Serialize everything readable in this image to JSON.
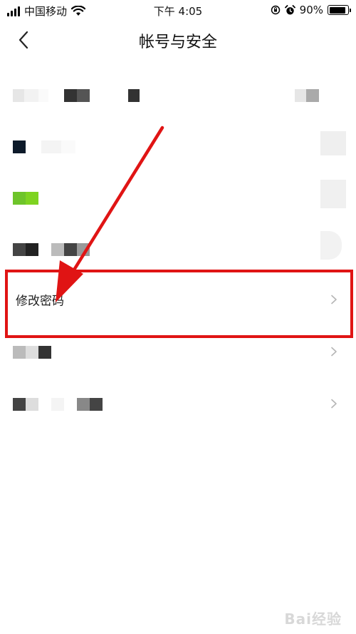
{
  "status_bar": {
    "carrier": "中国移动",
    "time": "下午 4:05",
    "battery_percent": "90%",
    "battery_level": 0.9
  },
  "nav": {
    "title": "帐号与安全"
  },
  "rows": {
    "change_password": "修改密码"
  },
  "icons": {
    "back": "back-chevron-icon",
    "row_arrow": "chevron-right-icon",
    "wifi": "wifi-icon",
    "signal": "signal-icon",
    "battery": "battery-icon",
    "alarm": "alarm-icon",
    "lock_rotation": "orientation-lock-icon"
  },
  "colors": {
    "annotation_red": "#e01414",
    "chevron_gray": "#b5b5b5",
    "blurred_green": "#7ed321"
  },
  "watermark": {
    "text": "Bai经验"
  }
}
